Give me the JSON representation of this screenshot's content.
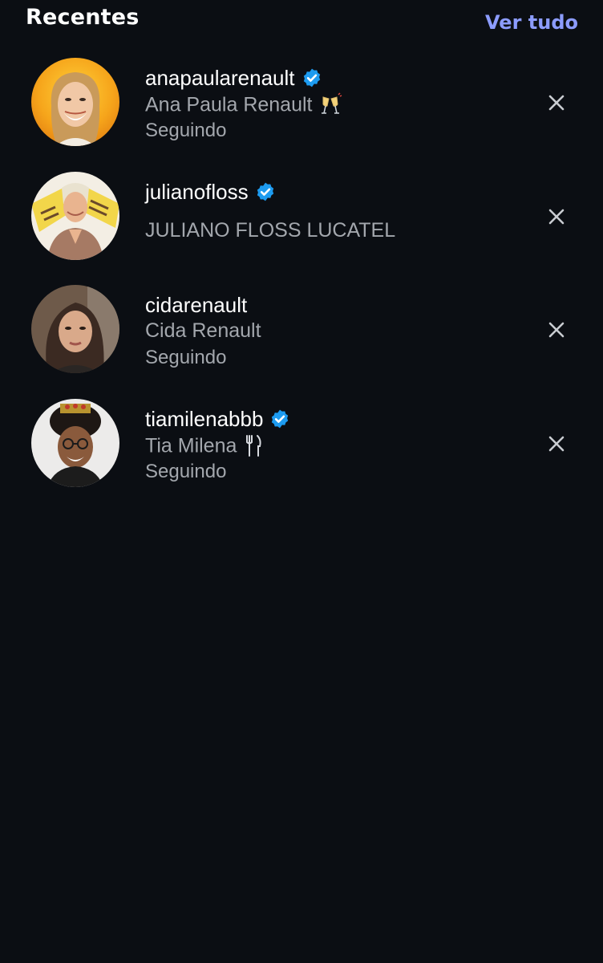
{
  "header": {
    "title": "Recentes",
    "see_all_label": "Ver tudo"
  },
  "recents": [
    {
      "username": "anapaularenault",
      "verified": true,
      "full_name": "Ana Paula Renault",
      "emoji": "champagne-glasses-icon",
      "status": "Seguindo"
    },
    {
      "username": "julianofloss",
      "verified": true,
      "full_name": "JULIANO FLOSS LUCATEL",
      "status": ""
    },
    {
      "username": "cidarenault",
      "verified": false,
      "full_name": "Cida Renault",
      "status": "Seguindo"
    },
    {
      "username": "tiamilenabbb",
      "verified": true,
      "full_name": "Tia Milena",
      "emoji": "fork-knife-icon",
      "status": "Seguindo"
    }
  ],
  "colors": {
    "background": "#0b0e13",
    "link": "#8c9cff",
    "verified": "#1d9bf0",
    "secondary_text": "#a3a7ad"
  }
}
